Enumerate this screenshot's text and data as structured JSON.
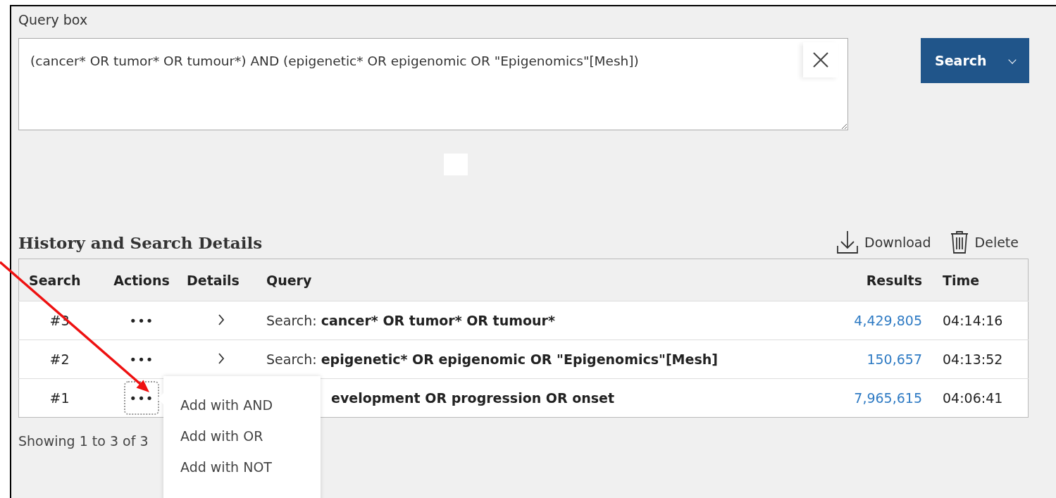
{
  "query_box": {
    "label": "Query box",
    "value": "(cancer* OR tumor* OR tumour*) AND (epigenetic* OR epigenomic OR \"Epigenomics\"[Mesh])"
  },
  "search_button": {
    "label": "Search"
  },
  "history": {
    "title": "History and Search Details",
    "actions": [
      {
        "kind": "download",
        "label": "Download"
      },
      {
        "kind": "delete",
        "label": "Delete"
      }
    ]
  },
  "table": {
    "columns": [
      "Search",
      "Actions",
      "Details",
      "Query",
      "Results",
      "Time"
    ],
    "rows": [
      {
        "number": "#3",
        "actions": "•••",
        "focused": false,
        "prefix": "Search:",
        "terms": "cancer* OR tumor* OR tumour*",
        "results": "4,429,805",
        "time": "04:14:16"
      },
      {
        "number": "#2",
        "actions": "•••",
        "focused": false,
        "prefix": "Search:",
        "terms": "epigenetic* OR epigenomic OR \"Epigenomics\"[Mesh]",
        "results": "150,657",
        "time": "04:13:52"
      },
      {
        "number": "#1",
        "actions": "•••",
        "focused": true,
        "terms": "evelopment OR progression OR onset",
        "results": "7,965,615",
        "time": "04:06:41"
      }
    ]
  },
  "footer": "Showing 1 to 3 of 3",
  "menu": {
    "items": [
      "Add with AND",
      "Add with OR",
      "Add with NOT"
    ]
  }
}
